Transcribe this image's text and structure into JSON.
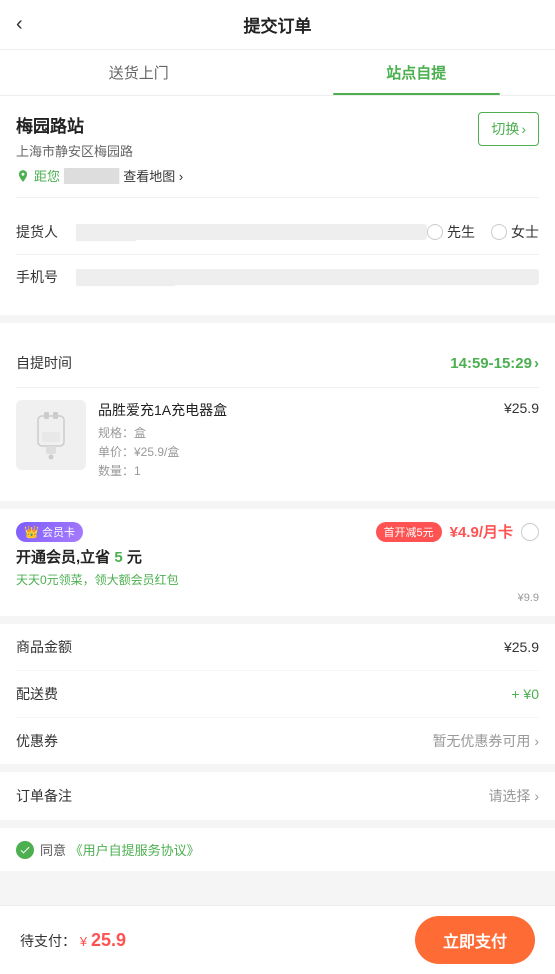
{
  "header": {
    "back_label": "‹",
    "title": "提交订单"
  },
  "tabs": [
    {
      "id": "delivery",
      "label": "送货上门",
      "active": false
    },
    {
      "id": "pickup",
      "label": "站点自提",
      "active": true
    }
  ],
  "station": {
    "name": "梅园路站",
    "address": "上海市静安区梅园路",
    "distance_prefix": "距您",
    "distance_blur": "██████",
    "map_link": "查看地图 ›",
    "switch_label": "切换",
    "switch_chevron": "›"
  },
  "form": {
    "pickup_person_label": "提货人",
    "pickup_person_placeholder": "██████",
    "gender_mr": "先生",
    "gender_ms": "女士",
    "phone_label": "手机号",
    "phone_placeholder": "██████████",
    "pickup_time_label": "自提时间",
    "pickup_time_value": "14:59-15:29",
    "pickup_time_chevron": "›"
  },
  "product": {
    "name": "品胜爱充1A充电器盒",
    "spec": "规格：盒",
    "unit_price": "单价：¥25.9/盒",
    "qty": "数量：1",
    "price": "¥25.9"
  },
  "member": {
    "badge_label": "会员卡",
    "first_discount_label": "首开减5元",
    "title_prefix": "开通会员,立省",
    "title_amount": "5",
    "title_suffix": "元",
    "subtitle": "天天0元领菜，领大额会员红包",
    "price": "¥4.9/月卡",
    "original_price": "¥9.9",
    "currency_symbol": "¥"
  },
  "price_list": [
    {
      "label": "商品金额",
      "value": "¥25.9"
    },
    {
      "label": "配送费",
      "value": "+ ¥0",
      "color": "green"
    },
    {
      "label": "优惠券",
      "value": "暂无优惠券可用 ›",
      "color": "gray"
    }
  ],
  "order_note": {
    "label": "订单备注",
    "placeholder": "请选择 ›"
  },
  "agreement": {
    "text_prefix": "同意",
    "link_text": "《用户自提服务协议》"
  },
  "bottom_bar": {
    "label": "待支付：",
    "currency": "¥",
    "amount": "25.9",
    "pay_btn": "立即支付"
  }
}
